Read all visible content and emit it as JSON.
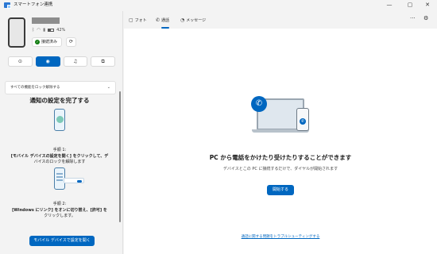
{
  "window": {
    "title": "スマートフォン連携",
    "controls": [
      "—",
      "▢",
      "✕"
    ]
  },
  "device": {
    "battery": "42%",
    "connection_status": "接続済み"
  },
  "sidebar": {
    "tabs": [
      {
        "name": "apps-tab",
        "icon": "⊙"
      },
      {
        "name": "calls-tab",
        "icon": "◉",
        "active": true
      },
      {
        "name": "music-tab",
        "icon": "♫"
      },
      {
        "name": "screen-tab",
        "icon": "⧉"
      }
    ],
    "unlock_text": "すべての機能をロック解除する",
    "notif_title": "通知の設定を完了する",
    "step1": {
      "label": "手順 1:",
      "line1": "[モバイル デバイスの設定を開く] をクリックして、デ",
      "line2": "バイスのロックを解除します"
    },
    "step2": {
      "label": "手順 2:",
      "line1": "[Windows にリンク] をオンに切り替え、[許可] を",
      "line2": "クリックします。"
    },
    "open_settings_button": "モバイル デバイスで設定を開く"
  },
  "main": {
    "tabs": [
      {
        "label": "フォト",
        "icon": "▢"
      },
      {
        "label": "通話",
        "icon": "✆",
        "active": true
      },
      {
        "label": "メッセージ",
        "icon": "◔"
      }
    ],
    "more_icon": "···",
    "settings_icon": "⚙",
    "hero_title": "PC から電話をかけたり受けたりすることができます",
    "hero_subtitle": "デバイスとこの PC に接続するだけで、ダイヤルが開始されます",
    "start_button": "開始する",
    "trouble_link": "通話に関する問題をトラブルシューティングする"
  },
  "colors": {
    "accent": "#0067c0",
    "success": "#107c10",
    "background": "#f3f3f3",
    "panel": "#ffffff"
  }
}
